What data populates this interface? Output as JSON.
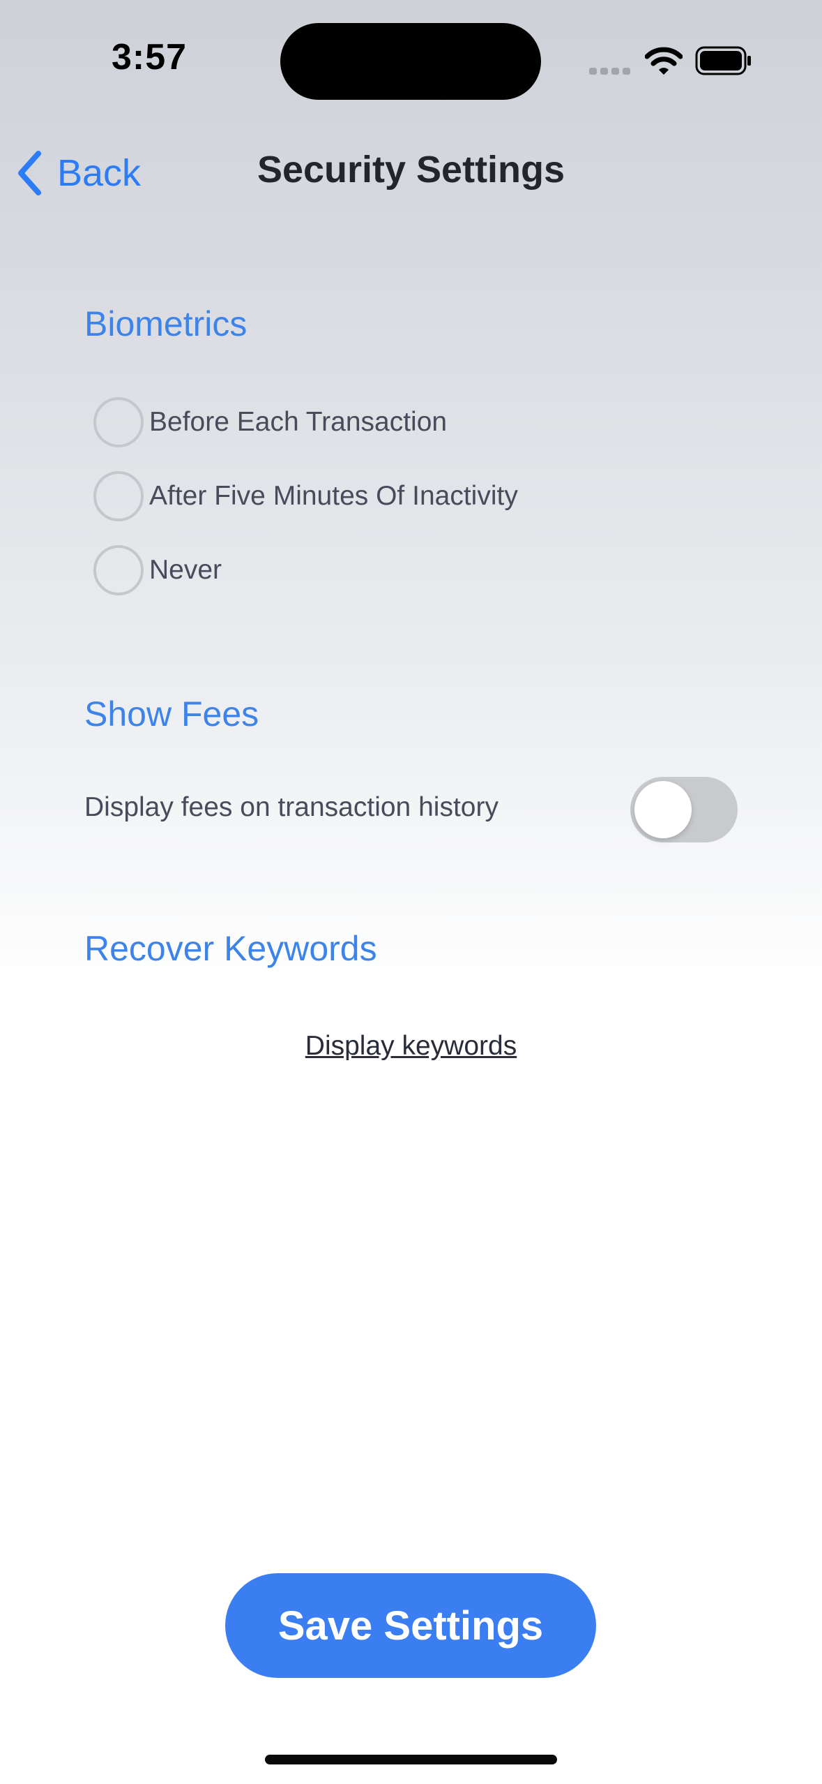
{
  "status_bar": {
    "time": "3:57"
  },
  "nav": {
    "back_label": "Back",
    "title": "Security Settings"
  },
  "biometrics": {
    "heading": "Biometrics",
    "options": [
      {
        "label": "Before Each Transaction",
        "selected": false
      },
      {
        "label": "After Five Minutes Of Inactivity",
        "selected": false
      },
      {
        "label": "Never",
        "selected": false
      }
    ]
  },
  "show_fees": {
    "heading": "Show Fees",
    "toggle_label": "Display fees on transaction history",
    "toggle_on": false
  },
  "recover_keywords": {
    "heading": "Recover Keywords",
    "link_label": "Display keywords"
  },
  "save_button": {
    "label": "Save Settings"
  },
  "colors": {
    "accent": "#3a7ef2",
    "heading": "#3d84ea",
    "back": "#2b7cf6"
  }
}
